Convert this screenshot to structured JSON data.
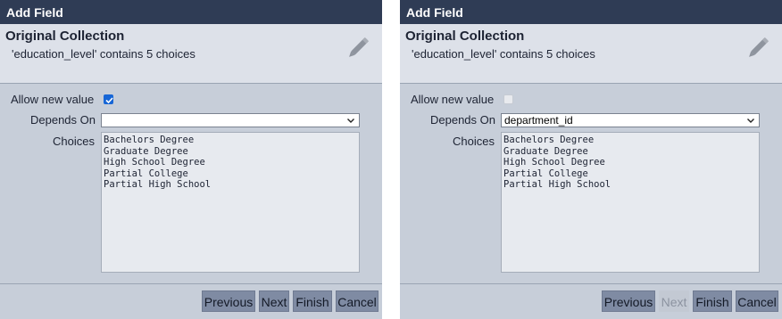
{
  "dialogs": [
    {
      "title": "Add Field",
      "collection_title": "Original Collection",
      "collection_sub": "'education_level' contains 5 choices",
      "allow_new_label": "Allow new value",
      "allow_new_checked": true,
      "depends_on_label": "Depends On",
      "depends_on_value": "",
      "choices_label": "Choices",
      "choices": [
        "Bachelors Degree",
        "Graduate Degree",
        "High School Degree",
        "Partial College",
        "Partial High School"
      ],
      "buttons": {
        "previous": "Previous",
        "next": "Next",
        "finish": "Finish",
        "cancel": "Cancel"
      },
      "next_disabled": false
    },
    {
      "title": "Add Field",
      "collection_title": "Original Collection",
      "collection_sub": "'education_level' contains 5 choices",
      "allow_new_label": "Allow new value",
      "allow_new_checked": false,
      "depends_on_label": "Depends On",
      "depends_on_value": "department_id",
      "choices_label": "Choices",
      "choices": [
        "Bachelors Degree",
        "Graduate Degree",
        "High School Degree",
        "Partial College",
        "Partial High School"
      ],
      "buttons": {
        "previous": "Previous",
        "next": "Next",
        "finish": "Finish",
        "cancel": "Cancel"
      },
      "next_disabled": true
    }
  ],
  "icons": {
    "edit": "pencil-icon",
    "dropdown": "chevron-down-icon",
    "check": "check-icon"
  },
  "colors": {
    "titlebar": "#2f3c55",
    "panel": "#c7ced9",
    "header": "#dde1e9",
    "button": "#7f8ba3",
    "checkbox": "#1766d6"
  }
}
